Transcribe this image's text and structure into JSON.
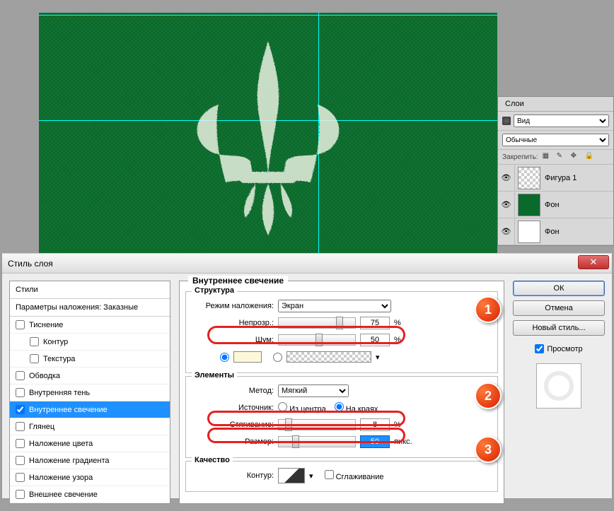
{
  "layers_panel": {
    "tab": "Слои",
    "kind_label": "Вид",
    "blend_mode": "Обычные",
    "lock_label": "Закрепить:",
    "items": [
      {
        "name": "Фигура 1"
      },
      {
        "name": "Фон"
      },
      {
        "name": "Фон"
      }
    ]
  },
  "dialog": {
    "title": "Стиль слоя",
    "close_glyph": "✕"
  },
  "styles": {
    "header": "Стили",
    "subheader": "Параметры наложения: Заказные",
    "items": [
      {
        "label": "Тиснение",
        "checked": false
      },
      {
        "label": "Контур",
        "checked": false,
        "indent": true
      },
      {
        "label": "Текстура",
        "checked": false,
        "indent": true
      },
      {
        "label": "Обводка",
        "checked": false
      },
      {
        "label": "Внутренняя тень",
        "checked": false
      },
      {
        "label": "Внутреннее свечение",
        "checked": true,
        "selected": true
      },
      {
        "label": "Глянец",
        "checked": false
      },
      {
        "label": "Наложение цвета",
        "checked": false
      },
      {
        "label": "Наложение градиента",
        "checked": false
      },
      {
        "label": "Наложение узора",
        "checked": false
      },
      {
        "label": "Внешнее свечение",
        "checked": false
      }
    ]
  },
  "inner_glow": {
    "title": "Внутреннее свечение",
    "structure": {
      "legend": "Структура",
      "blend_label": "Режим наложения:",
      "blend_value": "Экран",
      "opacity_label": "Непрозр.:",
      "opacity_value": "75",
      "noise_label": "Шум:",
      "noise_value": "50",
      "percent": "%"
    },
    "elements": {
      "legend": "Элементы",
      "method_label": "Метод:",
      "method_value": "Мягкий",
      "source_label": "Источник:",
      "source_center": "Из центра",
      "source_edge": "На краях",
      "choke_label": "Стягивание:",
      "choke_value": "8",
      "size_label": "Размер:",
      "size_value": "50",
      "percent": "%",
      "px": "пикс."
    },
    "quality": {
      "legend": "Качество",
      "contour_label": "Контур:",
      "antialias_label": "Сглаживание"
    }
  },
  "buttons": {
    "ok": "ОК",
    "cancel": "Отмена",
    "new_style": "Новый стиль...",
    "preview": "Просмотр"
  },
  "badges": {
    "b1": "1",
    "b2": "2",
    "b3": "3"
  }
}
